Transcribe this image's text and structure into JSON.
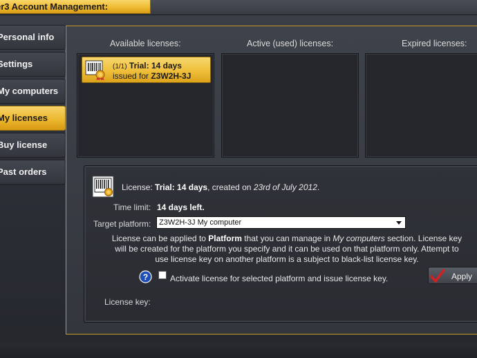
{
  "window": {
    "title": "er3 Account Management:"
  },
  "sidebar": {
    "items": [
      {
        "label": "Personal info",
        "active": false
      },
      {
        "label": "Settings",
        "active": false
      },
      {
        "label": "My computers",
        "active": false
      },
      {
        "label": "My licenses",
        "active": true
      },
      {
        "label": "Buy license",
        "active": false
      },
      {
        "label": "Past orders",
        "active": false
      }
    ]
  },
  "licenses": {
    "available_header": "Available licenses:",
    "active_header": "Active (used) licenses:",
    "expired_header": "Expired licenses:",
    "card": {
      "count": "(1/1)",
      "type_label": "Trial:",
      "duration": "14 days",
      "issued_prefix": "issued for",
      "issued_id": "Z3W2H-3J"
    }
  },
  "detail": {
    "license_label": "License:",
    "license_name": "Trial: 14 days",
    "created_prefix": ", created on",
    "created_date": "23rd of July 2012",
    "created_suffix": ".",
    "time_limit_label": "Time limit:",
    "time_limit_value": "14 days left.",
    "target_platform_label": "Target platform:",
    "target_platform_value": "Z3W2H-3J My computer",
    "desc_part1": "License can be applied to ",
    "desc_bold": "Platform",
    "desc_part2": " that you can manage in ",
    "desc_italic": "My computers",
    "desc_part3": " section. License key will be created for the platform you specify and it can be used on that platform only. Attempt to use license key on another platform is a subject to black-list license key.",
    "activate_label": "Activate license for selected platform and issue license key.",
    "apply_label": "Apply",
    "license_key_label": "License key:"
  },
  "colors": {
    "accent_gold": "#efbf3a",
    "panel_border": "#c79a2a",
    "help_blue": "#1e4fb8",
    "check_red": "#d42020"
  },
  "icons": {
    "license_card": "barcode-seal-icon",
    "detail": "barcode-seal-icon",
    "help": "help-icon",
    "apply": "check-icon",
    "dropdown": "chevron-down-icon"
  }
}
